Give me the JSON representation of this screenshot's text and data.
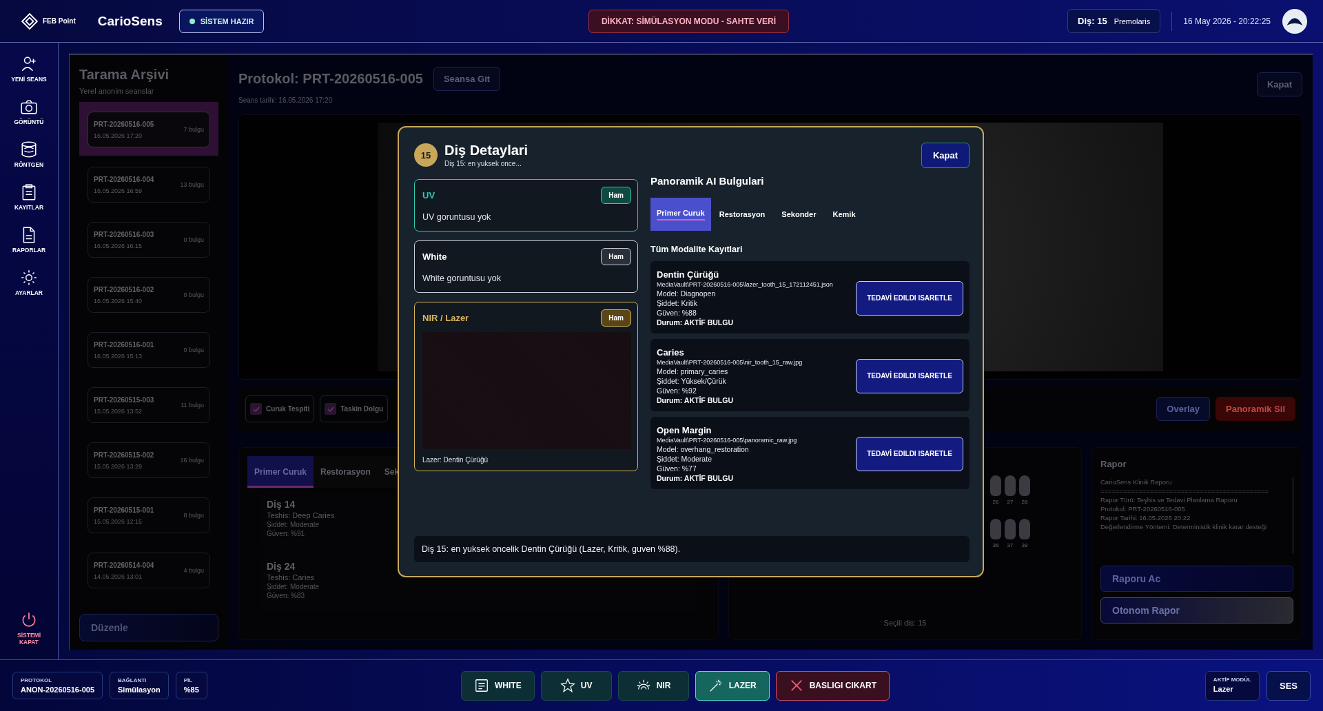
{
  "top_bar": {
    "logo": "FEB Point",
    "app_name": "CarioSens",
    "status": "SİSTEM HAZIR",
    "warning": "DİKKAT: SİMÜLASYON MODU - SAHTE VERİ",
    "tooth_label": "Diş: 15",
    "tooth_name": "Premolaris",
    "datetime": "16 May 2026 - 20:22:25"
  },
  "nav": [
    {
      "kind": "user",
      "label": "YENİ SEANS"
    },
    {
      "kind": "camera",
      "label": "GÖRÜNTÜ"
    },
    {
      "kind": "xray",
      "label": "RÖNTGEN"
    },
    {
      "kind": "clipboard",
      "label": "KAYITLAR"
    },
    {
      "kind": "document",
      "label": "RAPORLAR"
    },
    {
      "kind": "gear",
      "label": "AYARLAR"
    }
  ],
  "shutdown": "SİSTEMİ KAPAT",
  "archive": {
    "title": "Tarama Arşivi",
    "subtitle": "Yerel anonim seanslar",
    "items": [
      {
        "id": "PRT-20260516-005",
        "date": "16.05.2026 17:20",
        "count": "7 bulgu",
        "selected": true
      },
      {
        "id": "PRT-20260516-004",
        "date": "16.05.2026 16:59",
        "count": "13 bulgu",
        "selected": false
      },
      {
        "id": "PRT-20260516-003",
        "date": "16.05.2026 16:15",
        "count": "0 bulgu",
        "selected": false
      },
      {
        "id": "PRT-20260516-002",
        "date": "16.05.2026 15:40",
        "count": "0 bulgu",
        "selected": false
      },
      {
        "id": "PRT-20260516-001",
        "date": "16.05.2026 15:13",
        "count": "0 bulgu",
        "selected": false
      },
      {
        "id": "PRT-20260515-003",
        "date": "15.05.2026 13:52",
        "count": "11 bulgu",
        "selected": false
      },
      {
        "id": "PRT-20260515-002",
        "date": "15.05.2026 13:29",
        "count": "16 bulgu",
        "selected": false
      },
      {
        "id": "PRT-20260515-001",
        "date": "15.05.2026 12:15",
        "count": "8 bulgu",
        "selected": false
      },
      {
        "id": "PRT-20260514-004",
        "date": "14.05.2026 13:01",
        "count": "4 bulgu",
        "selected": false
      }
    ],
    "edit_button": "Düzenle"
  },
  "session": {
    "title": "Protokol: PRT-20260516-005",
    "go_button": "Seansa Git",
    "date": "Seans tarihi: 16.05.2026 17:20",
    "close_button": "Kapat"
  },
  "layers": [
    {
      "label": "Curuk Tespiti",
      "checked": true
    },
    {
      "label": "Taskin Dolgu",
      "checked": true
    }
  ],
  "overlay_button": "Overlay",
  "delete_button": "Panoramik Sil",
  "findings_tabs": [
    {
      "label": "Primer Curuk",
      "selected": true
    },
    {
      "label": "Restorasyon",
      "selected": false
    },
    {
      "label": "Sek",
      "selected": false
    }
  ],
  "findings": [
    {
      "tooth": "Diş 14",
      "diagnosis": "Teshis: Deep Caries",
      "severity": "Şiddet: Moderate",
      "confidence": "Güven: %91"
    },
    {
      "tooth": "Diş 24",
      "diagnosis": "Teshis: Caries",
      "severity": "Şiddet: Moderate",
      "confidence": "Güven: %83"
    }
  ],
  "tooth_chart": {
    "upper": [
      "26",
      "27",
      "28"
    ],
    "lower": [
      "36",
      "37",
      "38"
    ],
    "selected_text": "Seçili dis: 15"
  },
  "report": {
    "title": "Rapor",
    "lines": [
      "CarioSens Klinik Raporu",
      "============================================",
      "Rapor Türü: Teşhis ve Tedavi Planlama Raporu",
      "Protokol: PRT-20260516-005",
      "Rapor Tarihi: 16.05.2026 20:22",
      "Değerlendirme Yöntemi: Deterministik klinik karar desteği"
    ],
    "open_button": "Raporu Ac",
    "auto_button": "Otonom Rapor"
  },
  "modal": {
    "badge": "15",
    "title": "Diş Detaylari",
    "subtitle": "Diş 15: en yuksek once...",
    "close_button": "Kapat",
    "modalities": [
      {
        "kind": "uv",
        "title": "UV",
        "tag": "Ham",
        "text": "UV goruntusu yok"
      },
      {
        "kind": "white",
        "title": "White",
        "tag": "Ham",
        "text": "White goruntusu yok"
      },
      {
        "kind": "nir",
        "title": "NIR / Lazer",
        "tag": "Ham",
        "caption": "Lazer: Dentin Çürüğü"
      }
    ],
    "ai_title": "Panoramik AI Bulgulari",
    "tabs": [
      {
        "label": "Primer Curuk",
        "selected": true
      },
      {
        "label": "Restorasyon",
        "selected": false
      },
      {
        "label": "Sekonder",
        "selected": false
      },
      {
        "label": "Kemik",
        "selected": false
      }
    ],
    "records_title": "Tüm Modalite Kayıtlari",
    "records": [
      {
        "title": "Dentin Çürüğü",
        "path": "MediaVault\\PRT-20260516-005\\lazer_tooth_15_172112451.json",
        "model": "Model: Diagnopen",
        "severity": "Şiddet: Kritik",
        "confidence": "Güven: %88",
        "status": "Durum: AKTİF BULGU",
        "button": "TEDAVİ EDILDI ISARETLE"
      },
      {
        "title": "Caries",
        "path": "MediaVault\\PRT-20260516-005\\nir_tooth_15_raw.jpg",
        "model": "Model: primary_caries",
        "severity": "Şiddet: Yüksek/Çürük",
        "confidence": "Güven: %92",
        "status": "Durum: AKTİF BULGU",
        "button": "TEDAVİ EDILDI ISARETLE"
      },
      {
        "title": "Open Margin",
        "path": "MediaVault\\PRT-20260516-005\\panoramic_raw.jpg",
        "model": "Model: overhang_restoration",
        "severity": "Şiddet: Moderate",
        "confidence": "Güven: %77",
        "status": "Durum: AKTİF BULGU",
        "button": "TEDAVİ EDILDI ISARETLE"
      }
    ],
    "summary": "Diş 15: en yuksek oncelik Dentin Çürüğü (Lazer, Kritik, guven %88)."
  },
  "bottom_bar": {
    "info": [
      {
        "label": "PROTOKOL",
        "value": "ANON-20260516-005"
      },
      {
        "label": "BAĞLANTI",
        "value": "Simülasyon"
      },
      {
        "label": "PİL",
        "value": "%85"
      }
    ],
    "modes": [
      {
        "kind": "white",
        "label": "WHITE",
        "selected": false
      },
      {
        "kind": "uv",
        "label": "UV",
        "selected": false
      },
      {
        "kind": "nir",
        "label": "NIR",
        "selected": false
      },
      {
        "kind": "laser",
        "label": "LAZER",
        "selected": true
      }
    ],
    "remove_button": "BASLIGI CIKART",
    "module_label": "AKTİF MODÜL",
    "module_value": "Lazer",
    "sound_button": "SES"
  }
}
